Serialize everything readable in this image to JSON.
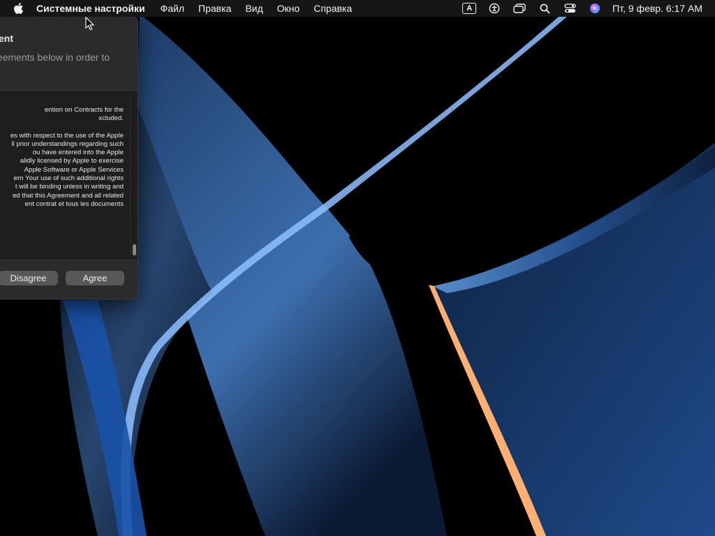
{
  "menubar": {
    "app_name": "Системные настройки",
    "items": [
      "Файл",
      "Правка",
      "Вид",
      "Окно",
      "Справка"
    ],
    "status_icons": [
      "keyboard-input-a-icon",
      "accessibility-icon",
      "screen-mirroring-icon",
      "spotlight-search-icon",
      "control-center-icon",
      "siri-icon"
    ],
    "input_source_label": "A",
    "clock": "Пт, 9 февр.  6:17 AM"
  },
  "window": {
    "title": "ent",
    "description_lines": [
      "eements below in order to"
    ],
    "license_lines": [
      "ention on Contracts for the",
      "xcluded.",
      "",
      "es with respect to the use of the Apple",
      "ll prior understandings regarding such",
      "ou have entered into the Apple",
      "alidly licensed by Apple to exercise",
      "Apple Software or Apple Services",
      "ern Your use of such additional rights",
      "t will be binding unless in writing and",
      "ed that this Agreement and all related",
      "ent contrat et tous les documents"
    ],
    "disagree_label": "Disagree",
    "agree_label": "Agree"
  }
}
